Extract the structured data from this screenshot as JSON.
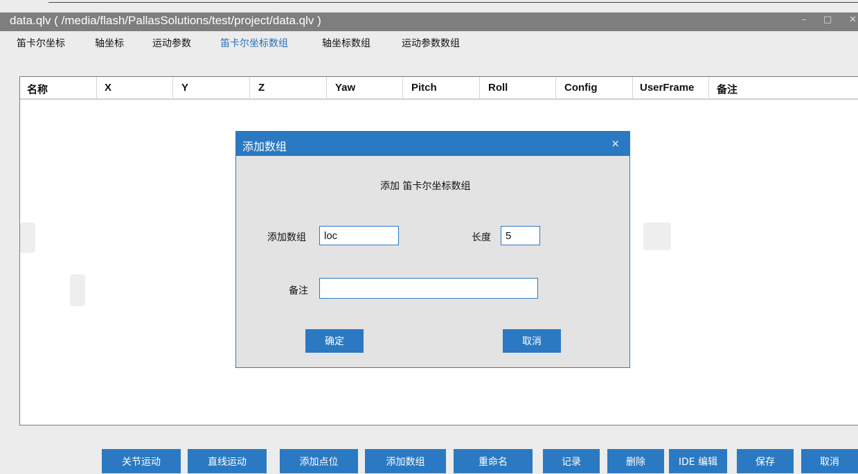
{
  "window": {
    "title": "data.qlv ( /media/flash/PallasSolutions/test/project/data.qlv )",
    "minimize_glyph": "–",
    "maximize_glyph": "□",
    "close_glyph": "✕"
  },
  "tabs": [
    {
      "label": "笛卡尔坐标"
    },
    {
      "label": "轴坐标"
    },
    {
      "label": "运动参数"
    },
    {
      "label": "笛卡尔坐标数组",
      "active": true
    },
    {
      "label": "轴坐标数组"
    },
    {
      "label": "运动参数数组"
    }
  ],
  "table": {
    "columns": [
      "名称",
      "X",
      "Y",
      "Z",
      "Yaw",
      "Pitch",
      "Roll",
      "Config",
      "UserFrame",
      "备注"
    ],
    "rows": []
  },
  "dialog": {
    "title": "添加数组",
    "close_glyph": "×",
    "subtitle": "添加  笛卡尔坐标数组",
    "name_label": "添加数组",
    "name_value": "loc",
    "length_label": "长度",
    "length_value": "5",
    "remark_label": "备注",
    "remark_value": "",
    "ok_label": "确定",
    "cancel_label": "取消"
  },
  "toolbar": {
    "buttons": [
      "关节运动",
      "直线运动",
      "添加点位",
      "添加数组",
      "重命名",
      "记录",
      "删除",
      "IDE 编辑",
      "保存",
      "取消"
    ]
  },
  "colors": {
    "accent": "#2b79c2",
    "titlebar": "#7e7e7e",
    "background": "#ececec",
    "active_tab": "#2b6fb6"
  }
}
